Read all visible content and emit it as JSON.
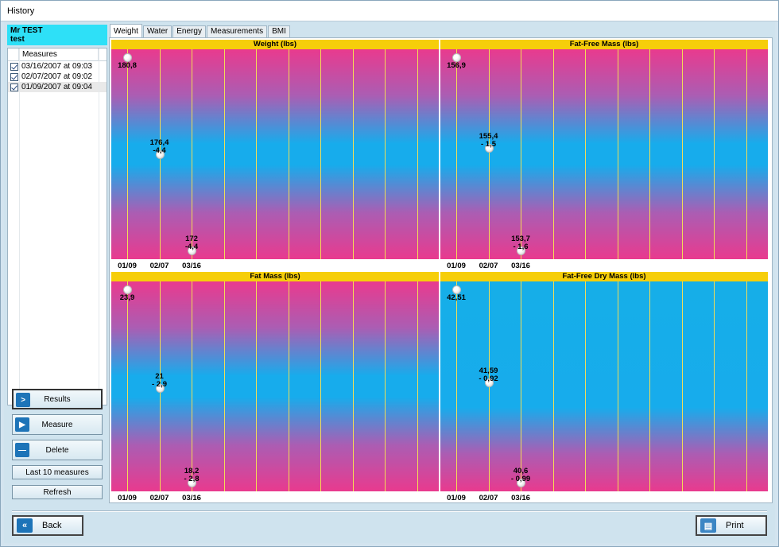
{
  "window": {
    "title": "History"
  },
  "user": {
    "name": "Mr TEST",
    "sub": "test"
  },
  "measures": {
    "header": "Measures",
    "items": [
      {
        "label": "03/16/2007 at 09:03",
        "checked": true
      },
      {
        "label": "02/07/2007 at 09:02",
        "checked": true
      },
      {
        "label": "01/09/2007 at 09:04",
        "checked": true
      }
    ]
  },
  "left_buttons": {
    "results": "Results",
    "measure": "Measure",
    "delete": "Delete",
    "last10": "Last 10 measures",
    "refresh": "Refresh"
  },
  "tabs": [
    "Weight",
    "Water",
    "Energy",
    "Measurements",
    "BMI"
  ],
  "bottom": {
    "back": "Back",
    "print": "Print"
  },
  "chart_data": [
    {
      "type": "scatter",
      "title": "Weight (lbs)",
      "categories": [
        "01/09",
        "02/07",
        "03/16"
      ],
      "values": [
        180.8,
        176.4,
        172
      ],
      "labels": [
        "180,8",
        "176,4",
        "172"
      ],
      "deltas": [
        "",
        "-4,4",
        "-4,4"
      ]
    },
    {
      "type": "scatter",
      "title": "Fat-Free Mass (lbs)",
      "categories": [
        "01/09",
        "02/07",
        "03/16"
      ],
      "values": [
        156.9,
        155.4,
        153.7
      ],
      "labels": [
        "156,9",
        "155,4",
        "153,7"
      ],
      "deltas": [
        "",
        "- 1,5",
        "- 1,6"
      ]
    },
    {
      "type": "scatter",
      "title": "Fat Mass (lbs)",
      "categories": [
        "01/09",
        "02/07",
        "03/16"
      ],
      "values": [
        23.9,
        21,
        18.2
      ],
      "labels": [
        "23,9",
        "21",
        "18,2"
      ],
      "deltas": [
        "",
        "- 2,9",
        "- 2,8"
      ]
    },
    {
      "type": "scatter",
      "title": "Fat-Free Dry Mass (lbs)",
      "categories": [
        "01/09",
        "02/07",
        "03/16"
      ],
      "values": [
        42.51,
        41.59,
        40.6
      ],
      "labels": [
        "42,51",
        "41,59",
        "40,6"
      ],
      "deltas": [
        "",
        "- 0,92",
        "- 0,99"
      ]
    }
  ]
}
